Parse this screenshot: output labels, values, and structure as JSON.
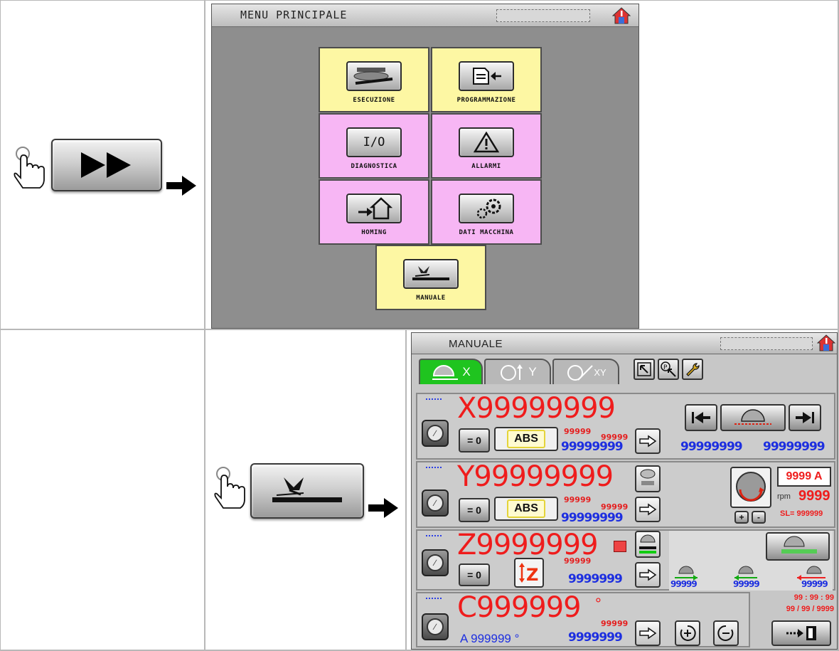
{
  "menu": {
    "title": "MENU PRINCIPALE",
    "tiles": [
      {
        "label": "ESECUZIONE",
        "color": "yellow"
      },
      {
        "label": "PROGRAMMAZIONE",
        "color": "yellow"
      },
      {
        "label": "DIAGNOSTICA",
        "color": "pink",
        "button_text": "I/O"
      },
      {
        "label": "ALLARMI",
        "color": "pink"
      },
      {
        "label": "HOMING",
        "color": "pink"
      },
      {
        "label": "DATI MACCHINA",
        "color": "pink"
      },
      {
        "label": "MANUALE",
        "color": "yellow"
      }
    ]
  },
  "manuale": {
    "title": "MANUALE",
    "tabs": [
      {
        "label": "X",
        "active": true,
        "icon": "saw-x-icon"
      },
      {
        "label": "Y",
        "active": false,
        "icon": "saw-y-icon"
      },
      {
        "label": "XY",
        "active": false,
        "icon": "saw-xy-icon"
      }
    ],
    "x_axis": {
      "value": "X99999999",
      "zero_label": "= 0",
      "mode_label": "ABS",
      "small_red_1": "99999",
      "small_red_2": "99999",
      "blue_value": "99999999",
      "right_blue_1": "99999999",
      "right_blue_2": "99999999"
    },
    "y_axis": {
      "value": "Y99999999",
      "zero_label": "= 0",
      "mode_label": "ABS",
      "small_red_1": "99999",
      "small_red_2": "99999",
      "blue_value": "99999999",
      "current_label": "9999 A",
      "rpm_unit": "rpm",
      "rpm_value": "9999",
      "sl_label": "SL= 999999",
      "minus": "-",
      "plus": "+"
    },
    "z_axis": {
      "value": "Z9999999",
      "zero_label": "= 0",
      "small_red": "99999",
      "blue_value": "9999999",
      "pos_1": "99999",
      "pos_2": "99999",
      "pos_3": "99999"
    },
    "c_axis": {
      "value": "C999999",
      "degree": "°",
      "a_value": "A 999999 °",
      "small_red": "99999",
      "blue_value": "9999999",
      "time": "99 : 99 : 99",
      "date": "99 / 99 / 9999"
    }
  },
  "colors": {
    "yellow_tile": "#fdf7a3",
    "pink_tile": "#f7b6f4",
    "active_tab": "#1fc41f",
    "axis_red": "#ef1c1c",
    "axis_blue": "#1d2fe0"
  }
}
